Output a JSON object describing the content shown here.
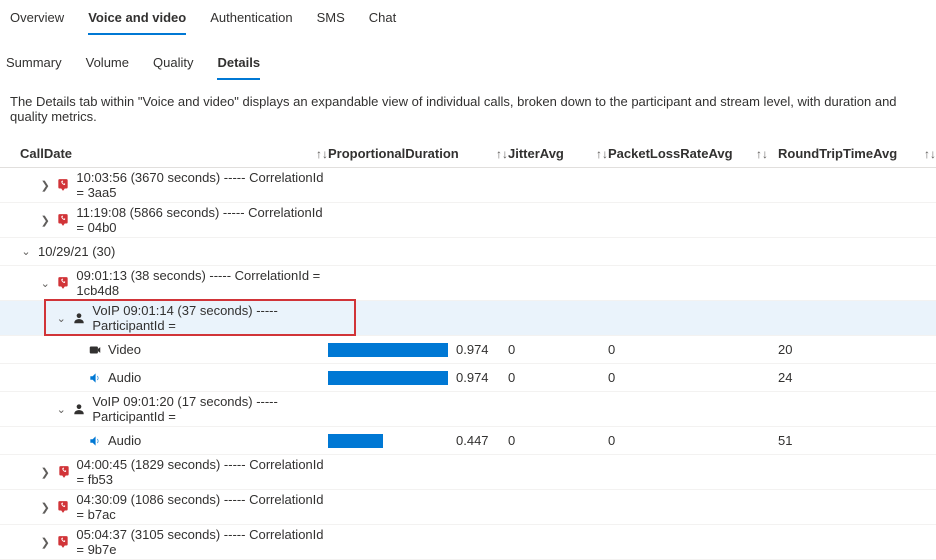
{
  "tabs": {
    "overview": "Overview",
    "voice_video": "Voice and video",
    "authentication": "Authentication",
    "sms": "SMS",
    "chat": "Chat"
  },
  "subtabs": {
    "summary": "Summary",
    "volume": "Volume",
    "quality": "Quality",
    "details": "Details"
  },
  "description": "The Details tab within \"Voice and video\" displays an expandable view of individual calls, broken down to the participant and stream level, with duration and quality metrics.",
  "columns": {
    "calldate": "CallDate",
    "prop": "ProportionalDuration",
    "jitter": "JitterAvg",
    "packet": "PacketLossRateAvg",
    "rtt": "RoundTripTimeAvg"
  },
  "sort_glyph": "↑↓",
  "rows": {
    "r0": {
      "label": "10:03:56 (3670 seconds) ----- CorrelationId = 3aa5"
    },
    "r1": {
      "label": "11:19:08 (5866 seconds) ----- CorrelationId = 04b0"
    },
    "g0": {
      "label": "10/29/21 (30)"
    },
    "r2": {
      "label": "09:01:13 (38 seconds) ----- CorrelationId = 1cb4d8"
    },
    "p0": {
      "label": "VoIP 09:01:14 (37 seconds) ----- ParticipantId ="
    },
    "s0": {
      "label": "Video",
      "prop": "0.974",
      "jitter": "0",
      "packet": "0",
      "rtt": "20",
      "bar": 100
    },
    "s1": {
      "label": "Audio",
      "prop": "0.974",
      "jitter": "0",
      "packet": "0",
      "rtt": "24",
      "bar": 100
    },
    "p1": {
      "label": "VoIP 09:01:20 (17 seconds) ----- ParticipantId ="
    },
    "s2": {
      "label": "Audio",
      "prop": "0.447",
      "jitter": "0",
      "packet": "0",
      "rtt": "51",
      "bar": 46
    },
    "r3": {
      "label": "04:00:45 (1829 seconds) ----- CorrelationId = fb53"
    },
    "r4": {
      "label": "04:30:09 (1086 seconds) ----- CorrelationId = b7ac"
    },
    "r5": {
      "label": "05:04:37 (3105 seconds) ----- CorrelationId = 9b7e"
    }
  },
  "chev": {
    "right": "❯",
    "down": "⌄"
  },
  "colors": {
    "accent": "#0078d4",
    "phone": "#d13438",
    "camera": "#323130",
    "speaker": "#0078d4"
  }
}
